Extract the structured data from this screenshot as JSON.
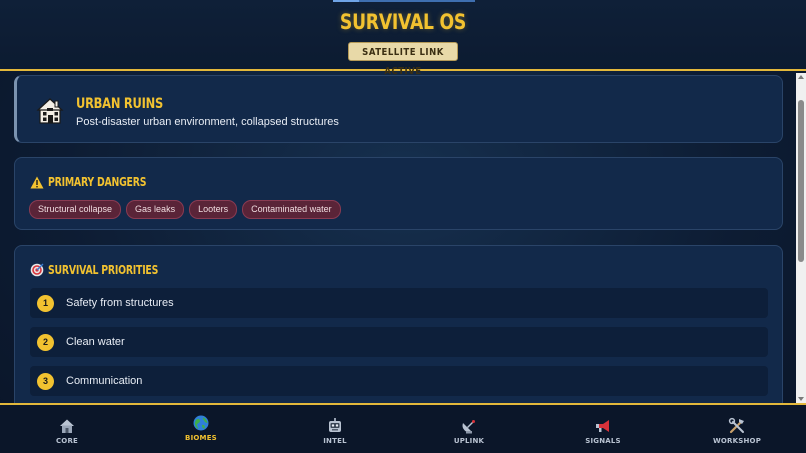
{
  "header": {
    "title": "SURVIVAL OS",
    "status_badge": "SATELLITE LINK ACTIVE"
  },
  "biome": {
    "icon": "house-icon",
    "title": "URBAN RUINS",
    "description": "Post-disaster urban environment, collapsed structures"
  },
  "dangers": {
    "icon": "warning-icon",
    "title": "PRIMARY DANGERS",
    "tags": [
      "Structural collapse",
      "Gas leaks",
      "Looters",
      "Contaminated water"
    ]
  },
  "priorities": {
    "icon": "target-icon",
    "title": "SURVIVAL PRIORITIES",
    "items": [
      {
        "num": "1",
        "text": "Safety from structures"
      },
      {
        "num": "2",
        "text": "Clean water"
      },
      {
        "num": "3",
        "text": "Communication"
      }
    ]
  },
  "nav": {
    "items": [
      {
        "label": "CORE",
        "icon": "home-icon"
      },
      {
        "label": "BIOMES",
        "icon": "globe-icon",
        "active": true
      },
      {
        "label": "INTEL",
        "icon": "robot-icon"
      },
      {
        "label": "UPLINK",
        "icon": "satellite-icon"
      },
      {
        "label": "SIGNALS",
        "icon": "megaphone-icon"
      },
      {
        "label": "WORKSHOP",
        "icon": "tools-icon"
      }
    ]
  },
  "colors": {
    "accent": "#f2c230",
    "background": "#0d1c33",
    "tag_bg": "#5a2438"
  }
}
